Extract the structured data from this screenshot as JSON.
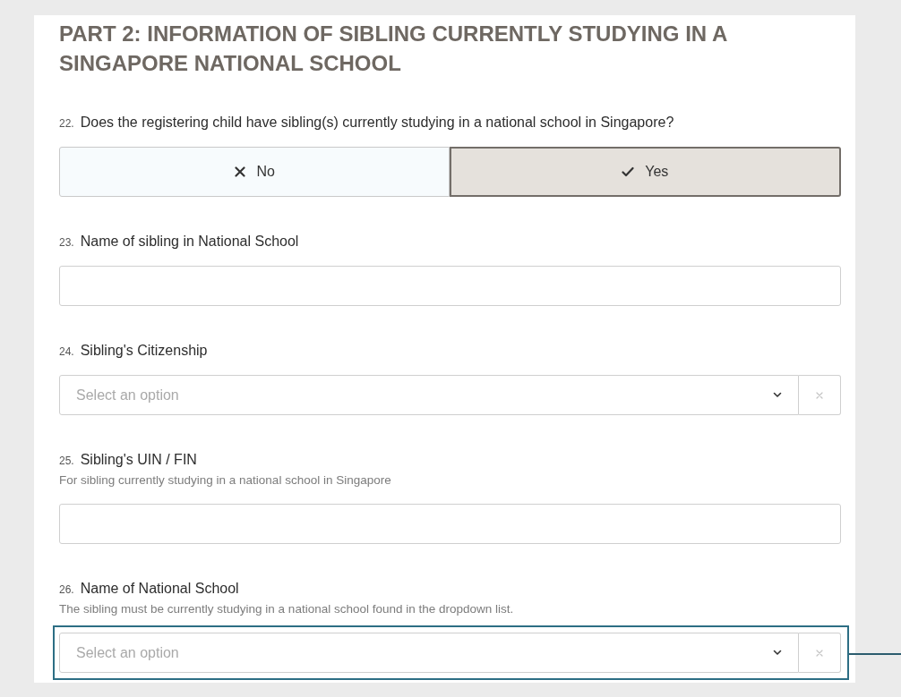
{
  "section": {
    "title": "PART 2: INFORMATION OF SIBLING CURRENTLY STUDYING IN A SINGAPORE NATIONAL SCHOOL"
  },
  "questions": [
    {
      "kind": "toggle",
      "number": "22.",
      "label": "Does the registering child have sibling(s) currently studying in a national school in Singapore?",
      "highlighted": false,
      "options": [
        {
          "kind": "no",
          "label": "No",
          "selected": false
        },
        {
          "kind": "yes",
          "label": "Yes",
          "selected": true
        }
      ]
    },
    {
      "kind": "text",
      "number": "23.",
      "label": "Name of sibling in National School",
      "highlighted": false
    },
    {
      "kind": "select",
      "number": "24.",
      "label": "Sibling's Citizenship",
      "placeholder": "Select an option",
      "highlighted": false
    },
    {
      "kind": "text",
      "number": "25.",
      "label": "Sibling's UIN / FIN",
      "hint": "For sibling currently studying in a national school in Singapore",
      "highlighted": false
    },
    {
      "kind": "select",
      "number": "26.",
      "label": "Name of National School",
      "hint": "The sibling must be currently studying in a national school found in the dropdown list.",
      "placeholder": "Select an option",
      "highlighted": true
    }
  ]
}
